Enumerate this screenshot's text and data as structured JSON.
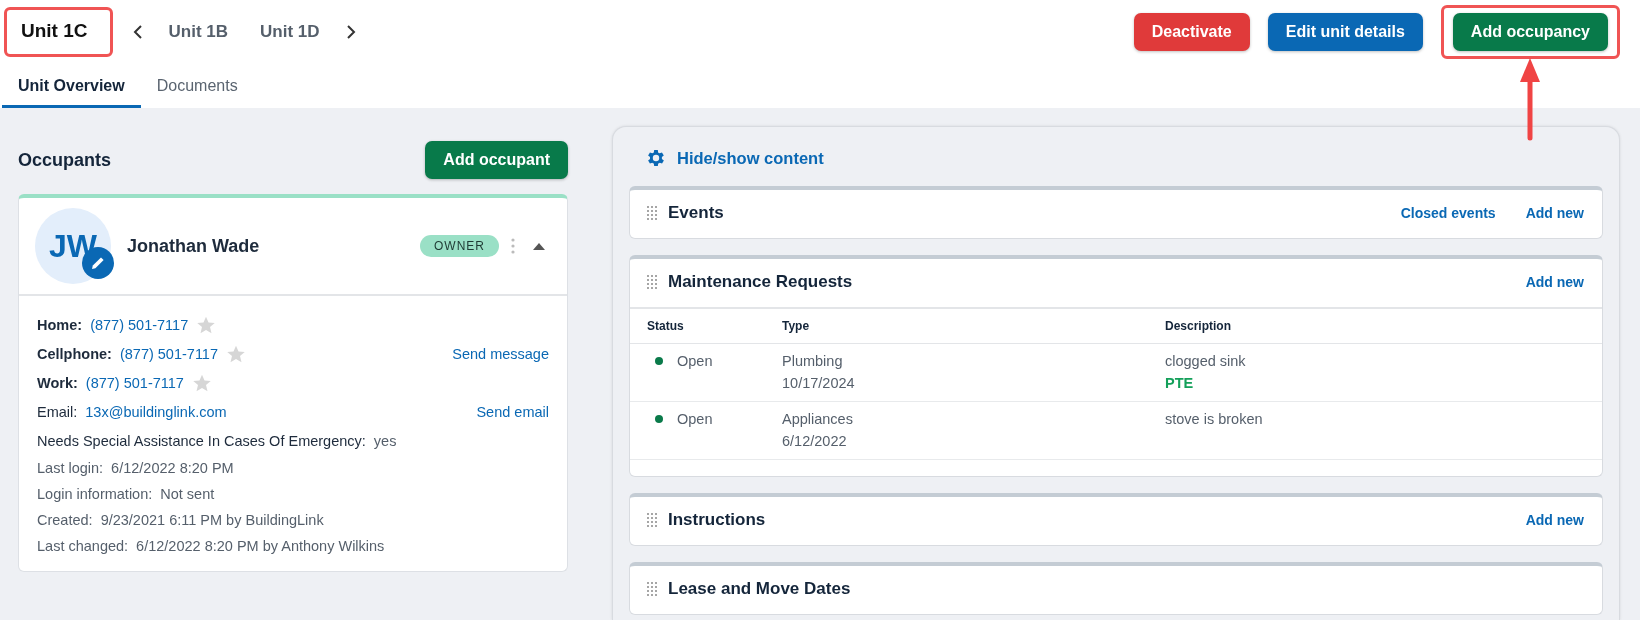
{
  "header": {
    "title": "Unit 1C",
    "prev_unit": "Unit 1B",
    "next_unit": "Unit 1D",
    "buttons": [
      {
        "label": "Deactivate",
        "kind": "danger"
      },
      {
        "label": "Edit unit details",
        "kind": "primary"
      },
      {
        "label": "Add occupancy",
        "kind": "success"
      }
    ]
  },
  "tabs": [
    {
      "label": "Unit Overview",
      "selected": true
    },
    {
      "label": "Documents",
      "selected": false
    }
  ],
  "occupants": {
    "title": "Occupants",
    "add_button": "Add occupant",
    "cards": [
      {
        "initials": "JW",
        "name": "Jonathan Wade",
        "role": "OWNER",
        "expanded": true,
        "phones": [
          {
            "label": "Home:",
            "number": "(877) 501-7117",
            "starred": false
          },
          {
            "label": "Cellphone:",
            "number": "(877) 501-7117",
            "starred": false,
            "action": "Send message"
          },
          {
            "label": "Work:",
            "number": "(877) 501-7117",
            "starred": false
          }
        ],
        "email_label": "Email:",
        "email": "13x@buildinglink.com",
        "send_email": "Send email",
        "assistance_label": "Needs Special Assistance In Cases Of Emergency:",
        "assistance_value": "yes",
        "details": [
          {
            "label": "Last login:",
            "value": "6/12/2022 8:20 PM"
          },
          {
            "label": "Login information:",
            "value": "Not sent"
          },
          {
            "label": "Created:",
            "value": "9/23/2021 6:11 PM by BuildingLink"
          },
          {
            "label": "Last changed:",
            "value": "6/12/2022 8:20 PM by Anthony Wilkins"
          }
        ]
      }
    ]
  },
  "content": {
    "hide_show": "Hide/show content",
    "sections": [
      {
        "title": "Events",
        "kind": "simple",
        "actions": [
          "Closed events",
          "Add new"
        ]
      },
      {
        "title": "Maintenance Requests",
        "kind": "table",
        "actions": [
          "Add new"
        ],
        "table": {
          "columns": [
            "Status",
            "Type",
            "Description"
          ],
          "rows": [
            {
              "status": "Open",
              "color": "#0a7a4a",
              "type": "Plumbing",
              "date": "10/17/2024",
              "description": "clogged sink",
              "tag": "PTE"
            },
            {
              "status": "Open",
              "color": "#0a7a4a",
              "type": "Appliances",
              "date": "6/12/2022",
              "description": "stove is broken"
            }
          ]
        }
      },
      {
        "title": "Instructions",
        "kind": "simple",
        "actions": [
          "Add new"
        ]
      },
      {
        "title": "Lease and Move Dates",
        "kind": "simple"
      }
    ]
  }
}
